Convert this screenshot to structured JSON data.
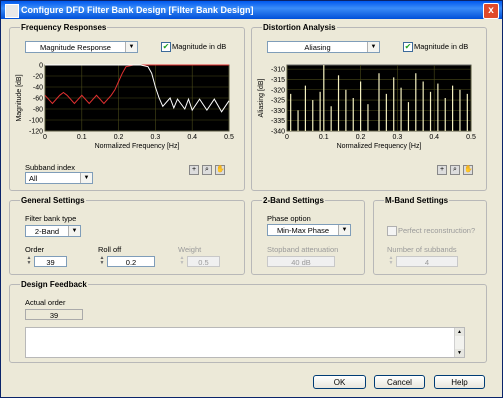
{
  "window": {
    "title": "Configure DFD Filter Bank Design [Filter Bank Design]",
    "close": "x"
  },
  "freq_group": {
    "title": "Frequency Responses",
    "dropdown": "Magnitude Response",
    "magnitude_in_db_label": "Magnitude in dB",
    "magnitude_in_db_checked": true,
    "subband_label": "Subband index",
    "subband_value": "All"
  },
  "dist_group": {
    "title": "Distortion Analysis",
    "dropdown": "Aliasing",
    "magnitude_in_db_label": "Magnitude in dB",
    "magnitude_in_db_checked": true
  },
  "general": {
    "title": "General Settings",
    "bank_type_label": "Filter bank type",
    "bank_type_value": "2-Band",
    "order_label": "Order",
    "order_value": "39",
    "rolloff_label": "Roll off",
    "rolloff_value": "0.2",
    "weight_label": "Weight",
    "weight_value": "0.5"
  },
  "two_band": {
    "title": "2-Band Settings",
    "phase_label": "Phase option",
    "phase_value": "Min-Max Phase",
    "atten_label": "Stopband attenuation",
    "atten_value": "40 dB"
  },
  "m_band": {
    "title": "M-Band Settings",
    "perfect_label": "Perfect reconstruction?",
    "perfect_checked": false,
    "subbands_label": "Number of subbands",
    "subbands_value": "4"
  },
  "feedback": {
    "title": "Design Feedback",
    "actual_order_label": "Actual order",
    "actual_order_value": "39",
    "messages": ""
  },
  "buttons": {
    "ok": "OK",
    "cancel": "Cancel",
    "help": "Help"
  },
  "tool_icons": [
    "crosshair-icon",
    "zoom-icon",
    "pan-icon"
  ],
  "chart_data": [
    {
      "type": "line",
      "xlabel": "Normalized Frequency [Hz]",
      "ylabel": "Magnitude [dB]",
      "xlim": [
        0,
        0.5
      ],
      "ylim": [
        -120,
        0
      ],
      "xticks": [
        "0",
        "0.1",
        "0.2",
        "0.3",
        "0.4",
        "0.5"
      ],
      "yticks": [
        "0",
        "-20",
        "-40",
        "-60",
        "-80",
        "-100",
        "-120"
      ],
      "series": [
        {
          "color": "#e03030",
          "x": [
            0,
            0.02,
            0.04,
            0.05,
            0.06,
            0.08,
            0.1,
            0.12,
            0.14,
            0.16,
            0.18,
            0.19,
            0.2,
            0.21,
            0.22,
            0.24,
            0.3,
            0.4,
            0.5
          ],
          "y": [
            -55,
            -70,
            -55,
            -50,
            -55,
            -70,
            -55,
            -70,
            -55,
            -70,
            -55,
            -45,
            -30,
            -15,
            -3,
            0,
            0,
            0,
            0
          ]
        },
        {
          "color": "#ffffff",
          "x": [
            0,
            0.2,
            0.26,
            0.28,
            0.29,
            0.3,
            0.31,
            0.32,
            0.34,
            0.35,
            0.36,
            0.38,
            0.39,
            0.4,
            0.42,
            0.44,
            0.46,
            0.48,
            0.5
          ],
          "y": [
            0,
            0,
            0,
            -3,
            -15,
            -40,
            -60,
            -75,
            -60,
            -78,
            -62,
            -80,
            -62,
            -82,
            -62,
            -82,
            -62,
            -85,
            -65
          ]
        }
      ]
    },
    {
      "type": "bar",
      "xlabel": "Normalized Frequency [Hz]",
      "ylabel": "Aliasing [dB]",
      "xlim": [
        0,
        0.5
      ],
      "ylim": [
        -340,
        -308
      ],
      "xticks": [
        "0",
        "0.1",
        "0.2",
        "0.3",
        "0.4",
        "0.5"
      ],
      "yticks": [
        "-310",
        "-315",
        "-320",
        "-325",
        "-330",
        "-335",
        "-340"
      ],
      "series": [
        {
          "color": "#f4f0c0",
          "x": [
            0.01,
            0.03,
            0.05,
            0.07,
            0.09,
            0.1,
            0.12,
            0.14,
            0.16,
            0.18,
            0.2,
            0.22,
            0.25,
            0.27,
            0.29,
            0.31,
            0.33,
            0.35,
            0.37,
            0.39,
            0.41,
            0.43,
            0.45,
            0.47,
            0.49
          ],
          "y": [
            -322,
            -330,
            -318,
            -325,
            -321,
            -308,
            -328,
            -313,
            -320,
            -324,
            -316,
            -327,
            -312,
            -322,
            -314,
            -319,
            -326,
            -312,
            -316,
            -321,
            -317,
            -324,
            -318,
            -320,
            -322
          ]
        }
      ]
    }
  ]
}
